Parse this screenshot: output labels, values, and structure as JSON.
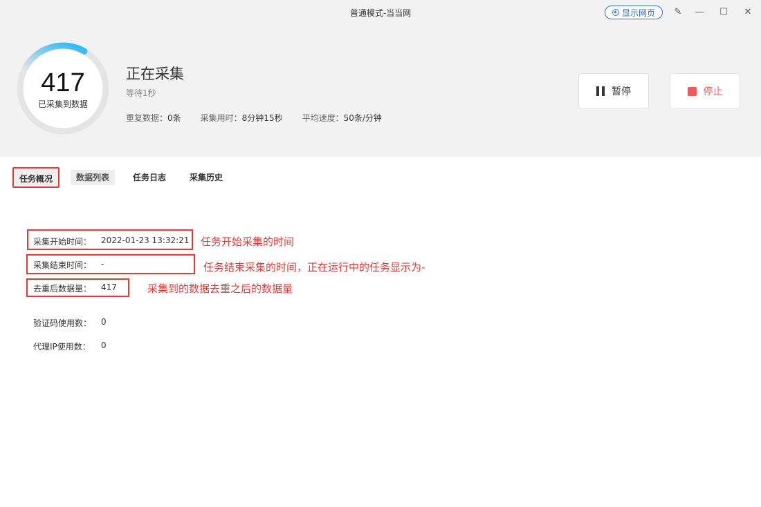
{
  "window": {
    "title": "普通模式-当当网",
    "show_web_label": "显示网页"
  },
  "progress": {
    "count": "417",
    "count_label": "已采集到数据",
    "ring_fraction": 0.12,
    "ring_color": "#29b6f6"
  },
  "status": {
    "title": "正在采集",
    "subtitle": "等待1秒",
    "stats": [
      {
        "label": "重复数据：",
        "value": "0条"
      },
      {
        "label": "采集用时：",
        "value": "8分钟15秒"
      },
      {
        "label": "平均速度：",
        "value": "50条/分钟"
      }
    ]
  },
  "buttons": {
    "pause": "暂停",
    "stop": "停止"
  },
  "tabs": [
    {
      "label": "任务概况",
      "active": true
    },
    {
      "label": "数据列表"
    },
    {
      "label": "任务日志"
    },
    {
      "label": "采集历史"
    }
  ],
  "overview": [
    {
      "label": "采集开始时间：",
      "value": "2022-01-23 13:32:21"
    },
    {
      "label": "采集结束时间：",
      "value": "-"
    },
    {
      "label": "去重后数据量：",
      "value": "417"
    },
    {
      "label": "验证码使用数：",
      "value": "0"
    },
    {
      "label": "代理IP使用数：",
      "value": "0"
    }
  ],
  "annotations": {
    "start": "任务开始采集的时间",
    "end": "任务结束采集的时间，正在运行中的任务显示为-",
    "dedup": "采集到的数据去重之后的数据量"
  },
  "colors": {
    "accent_blue": "#2f6fd8",
    "stop_red": "#f15a5a",
    "annotation_red": "#e53935"
  }
}
